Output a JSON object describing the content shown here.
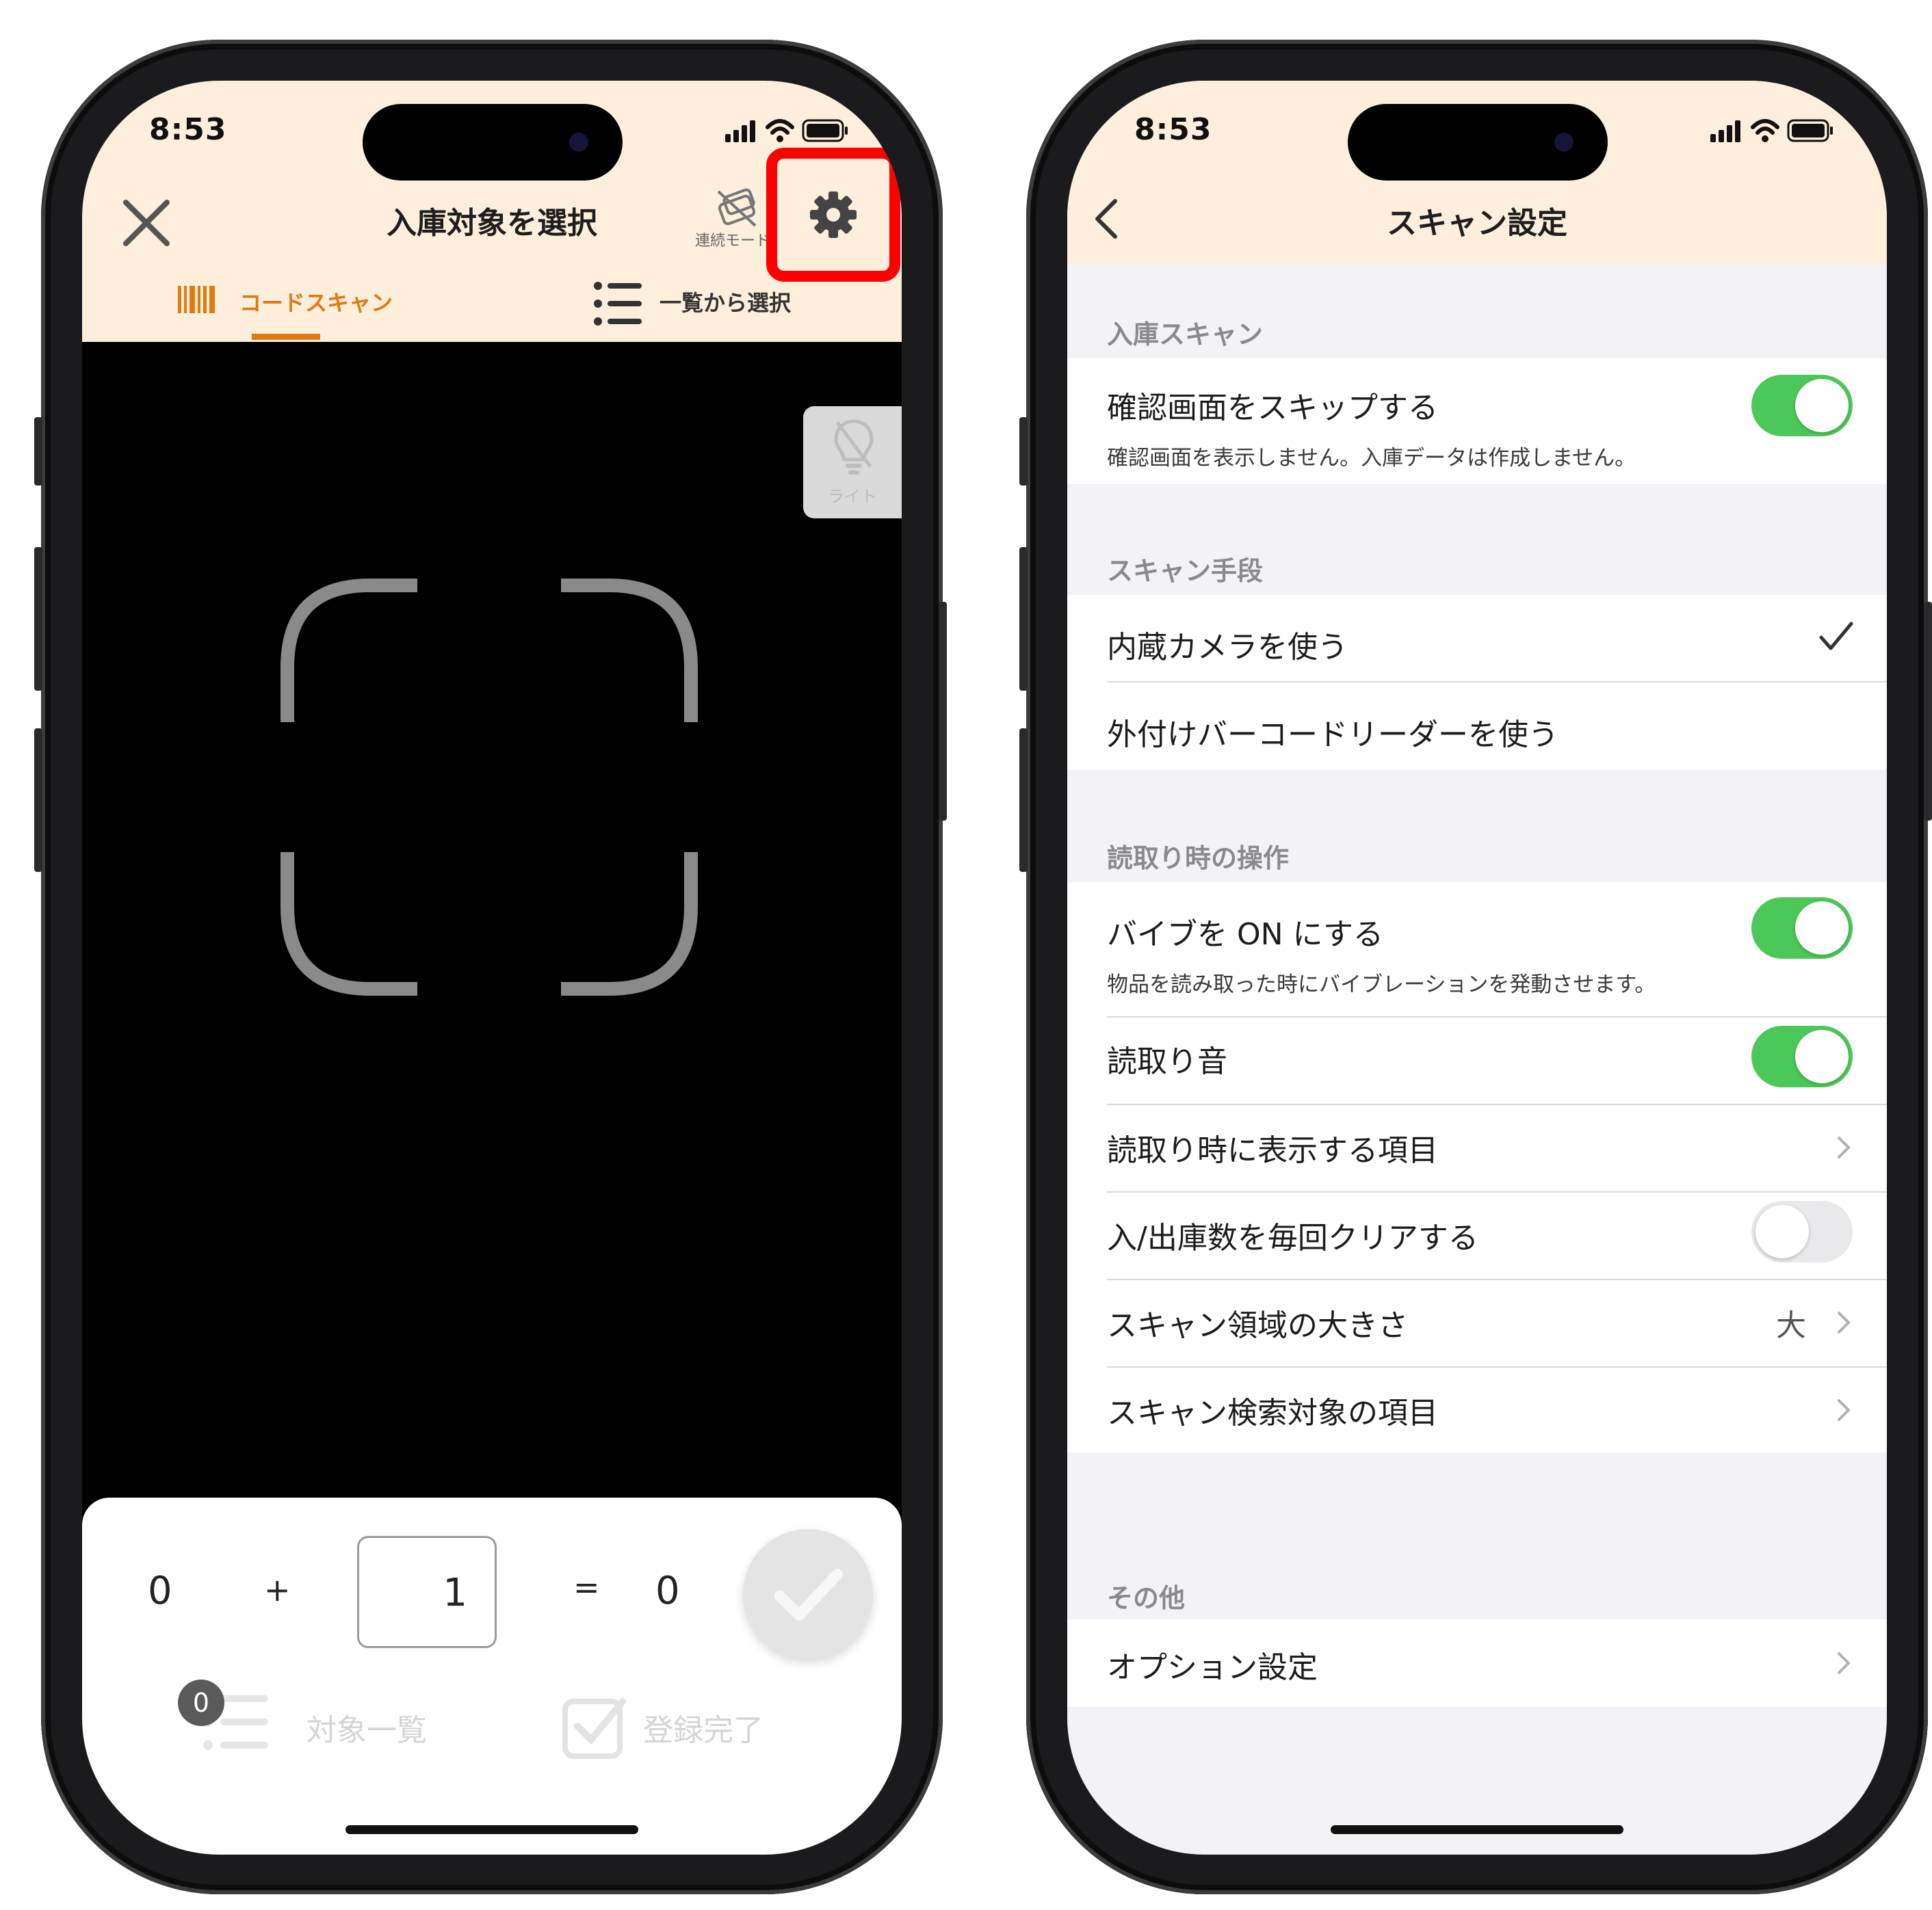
{
  "left_screen": {
    "status_bar": {
      "time": "8:53"
    },
    "header": {
      "title": "入庫対象を選択",
      "continuous_mode_label": "連続モード",
      "tabs": [
        {
          "label": "コードスキャン",
          "active": true
        },
        {
          "label": "一覧から選択",
          "active": false
        }
      ]
    },
    "light_button_label": "ライト",
    "calculator": {
      "current": "0",
      "plus": "+",
      "quantity": "1",
      "equals": "=",
      "result": "0"
    },
    "footer": {
      "badge_count": "0",
      "target_list_label": "対象一覧",
      "complete_label": "登録完了"
    },
    "highlight_color": "#ff0000",
    "accent_color": "#e07a10"
  },
  "right_screen": {
    "status_bar": {
      "time": "8:53"
    },
    "header": {
      "title": "スキャン設定"
    },
    "sections": {
      "incoming_scan": {
        "title": "入庫スキャン",
        "skip_confirm": {
          "label": "確認画面をスキップする",
          "description": "確認画面を表示しません。入庫データは作成しません。",
          "enabled": true
        }
      },
      "scan_method": {
        "title": "スキャン手段",
        "builtin_camera": {
          "label": "内蔵カメラを使う",
          "selected": true
        },
        "external_reader": {
          "label": "外付けバーコードリーダーを使う",
          "selected": false
        }
      },
      "on_read": {
        "title": "読取り時の操作",
        "vibrate": {
          "label": "バイブを ON にする",
          "description": "物品を読み取った時にバイブレーションを発動させます。",
          "enabled": true
        },
        "sound": {
          "label": "読取り音",
          "enabled": true
        },
        "display_items": {
          "label": "読取り時に表示する項目"
        },
        "clear_quantity": {
          "label": "入/出庫数を毎回クリアする",
          "enabled": false
        },
        "scan_area_size": {
          "label": "スキャン領域の大きさ",
          "value": "大"
        },
        "search_target": {
          "label": "スキャン検索対象の項目"
        }
      },
      "other": {
        "title": "その他",
        "options": {
          "label": "オプション設定"
        }
      }
    },
    "toggle_on_color": "#4cc858"
  }
}
